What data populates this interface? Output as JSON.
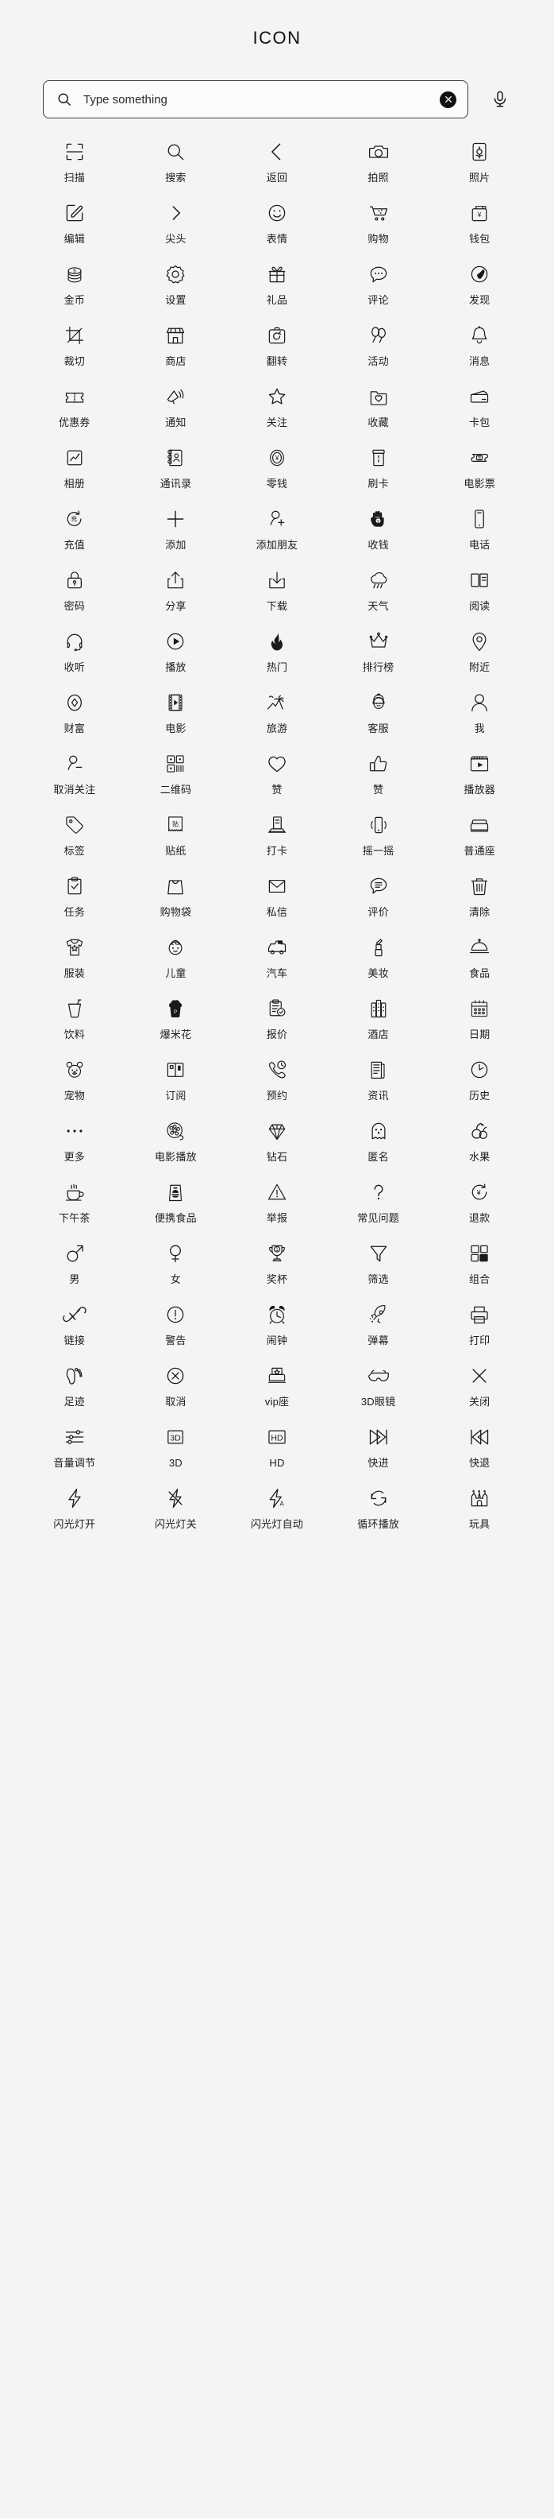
{
  "header": {
    "title": "ICON"
  },
  "search": {
    "placeholder": "Type something",
    "value": "",
    "search_icon": "search-icon",
    "clear_icon": "clear-circle-icon",
    "mic_icon": "microphone-icon"
  },
  "icons": [
    {
      "label": "扫描",
      "icon": "scan-icon"
    },
    {
      "label": "搜索",
      "icon": "search-icon"
    },
    {
      "label": "返回",
      "icon": "chevron-left-icon"
    },
    {
      "label": "拍照",
      "icon": "camera-icon"
    },
    {
      "label": "照片",
      "icon": "photo-icon"
    },
    {
      "label": "编辑",
      "icon": "edit-pencil-icon"
    },
    {
      "label": "尖头",
      "icon": "chevron-right-icon"
    },
    {
      "label": "表情",
      "icon": "smiley-face-icon"
    },
    {
      "label": "购物",
      "icon": "shopping-cart-icon"
    },
    {
      "label": "钱包",
      "icon": "wallet-icon"
    },
    {
      "label": "金币",
      "icon": "coins-icon"
    },
    {
      "label": "设置",
      "icon": "gear-icon"
    },
    {
      "label": "礼品",
      "icon": "gift-icon"
    },
    {
      "label": "评论",
      "icon": "comment-bubble-icon"
    },
    {
      "label": "发现",
      "icon": "compass-globe-icon"
    },
    {
      "label": "裁切",
      "icon": "crop-icon"
    },
    {
      "label": "商店",
      "icon": "storefront-icon"
    },
    {
      "label": "翻转",
      "icon": "camera-flip-icon"
    },
    {
      "label": "活动",
      "icon": "balloons-icon"
    },
    {
      "label": "消息",
      "icon": "bell-icon"
    },
    {
      "label": "优惠券",
      "icon": "coupon-ticket-icon"
    },
    {
      "label": "通知",
      "icon": "notification-horn-icon"
    },
    {
      "label": "关注",
      "icon": "star-outline-icon"
    },
    {
      "label": "收藏",
      "icon": "folder-heart-icon"
    },
    {
      "label": "卡包",
      "icon": "card-stack-icon"
    },
    {
      "label": "相册",
      "icon": "album-chart-icon"
    },
    {
      "label": "通讯录",
      "icon": "contacts-book-icon"
    },
    {
      "label": "零钱",
      "icon": "coin-yuan-icon"
    },
    {
      "label": "刷卡",
      "icon": "card-swipe-icon"
    },
    {
      "label": "电影票",
      "icon": "movie-ticket-icon"
    },
    {
      "label": "充值",
      "icon": "recharge-icon"
    },
    {
      "label": "添加",
      "icon": "plus-icon"
    },
    {
      "label": "添加朋友",
      "icon": "add-friend-icon"
    },
    {
      "label": "收钱",
      "icon": "receive-money-hand-icon"
    },
    {
      "label": "电话",
      "icon": "phone-device-icon"
    },
    {
      "label": "密码",
      "icon": "lock-icon"
    },
    {
      "label": "分享",
      "icon": "share-upload-icon"
    },
    {
      "label": "下载",
      "icon": "download-icon"
    },
    {
      "label": "天气",
      "icon": "rain-cloud-icon"
    },
    {
      "label": "阅读",
      "icon": "open-book-icon"
    },
    {
      "label": "收听",
      "icon": "headset-icon"
    },
    {
      "label": "播放",
      "icon": "play-circle-icon"
    },
    {
      "label": "热门",
      "icon": "flame-icon"
    },
    {
      "label": "排行榜",
      "icon": "crown-icon"
    },
    {
      "label": "附近",
      "icon": "location-pin-icon"
    },
    {
      "label": "财富",
      "icon": "wealth-coin-icon"
    },
    {
      "label": "电影",
      "icon": "film-strip-icon"
    },
    {
      "label": "旅游",
      "icon": "palm-travel-icon"
    },
    {
      "label": "客服",
      "icon": "customer-service-icon"
    },
    {
      "label": "我",
      "icon": "user-icon"
    },
    {
      "label": "取消关注",
      "icon": "remove-friend-icon"
    },
    {
      "label": "二维码",
      "icon": "qr-code-icon"
    },
    {
      "label": "赞",
      "icon": "heart-outline-icon"
    },
    {
      "label": "赞",
      "icon": "thumbs-up-icon"
    },
    {
      "label": "播放器",
      "icon": "video-player-icon"
    },
    {
      "label": "标签",
      "icon": "tag-icon"
    },
    {
      "label": "贴纸",
      "icon": "sticker-icon"
    },
    {
      "label": "打卡",
      "icon": "check-in-icon"
    },
    {
      "label": "摇一摇",
      "icon": "shake-phone-icon"
    },
    {
      "label": "普通座",
      "icon": "normal-seat-icon"
    },
    {
      "label": "任务",
      "icon": "task-clipboard-icon"
    },
    {
      "label": "购物袋",
      "icon": "shopping-bag-icon"
    },
    {
      "label": "私信",
      "icon": "envelope-icon"
    },
    {
      "label": "评价",
      "icon": "review-bubble-icon"
    },
    {
      "label": "清除",
      "icon": "trash-icon"
    },
    {
      "label": "服装",
      "icon": "clothing-icon"
    },
    {
      "label": "儿童",
      "icon": "child-face-icon"
    },
    {
      "label": "汽车",
      "icon": "car-icon"
    },
    {
      "label": "美妆",
      "icon": "lipstick-icon"
    },
    {
      "label": "食品",
      "icon": "food-cloche-icon"
    },
    {
      "label": "饮料",
      "icon": "drink-cup-icon"
    },
    {
      "label": "爆米花",
      "icon": "popcorn-icon"
    },
    {
      "label": "报价",
      "icon": "quote-clipboard-icon"
    },
    {
      "label": "酒店",
      "icon": "hotel-building-icon"
    },
    {
      "label": "日期",
      "icon": "calendar-icon"
    },
    {
      "label": "宠物",
      "icon": "pet-bear-icon"
    },
    {
      "label": "订阅",
      "icon": "subscribe-book-icon"
    },
    {
      "label": "预约",
      "icon": "appointment-phone-icon"
    },
    {
      "label": "资讯",
      "icon": "news-icon"
    },
    {
      "label": "历史",
      "icon": "clock-history-icon"
    },
    {
      "label": "更多",
      "icon": "more-dots-icon"
    },
    {
      "label": "电影播放",
      "icon": "film-reel-icon"
    },
    {
      "label": "钻石",
      "icon": "diamond-icon"
    },
    {
      "label": "匿名",
      "icon": "ghost-anonymous-icon"
    },
    {
      "label": "水果",
      "icon": "fruit-icon"
    },
    {
      "label": "下午茶",
      "icon": "tea-cup-icon"
    },
    {
      "label": "便携食品",
      "icon": "takeaway-food-icon"
    },
    {
      "label": "举报",
      "icon": "warning-triangle-icon"
    },
    {
      "label": "常见问题",
      "icon": "question-mark-icon"
    },
    {
      "label": "退款",
      "icon": "refund-yuan-icon"
    },
    {
      "label": "男",
      "icon": "male-icon"
    },
    {
      "label": "女",
      "icon": "female-icon"
    },
    {
      "label": "奖杯",
      "icon": "trophy-icon"
    },
    {
      "label": "筛选",
      "icon": "filter-funnel-icon"
    },
    {
      "label": "组合",
      "icon": "grid-combo-icon"
    },
    {
      "label": "链接",
      "icon": "link-chain-icon"
    },
    {
      "label": "警告",
      "icon": "exclamation-circle-icon"
    },
    {
      "label": "闹钟",
      "icon": "alarm-clock-icon"
    },
    {
      "label": "弹幕",
      "icon": "rocket-icon"
    },
    {
      "label": "打印",
      "icon": "printer-icon"
    },
    {
      "label": "足迹",
      "icon": "footprint-icon"
    },
    {
      "label": "取消",
      "icon": "cancel-circle-icon"
    },
    {
      "label": "vip座",
      "icon": "vip-seat-icon"
    },
    {
      "label": "3D眼镜",
      "icon": "3d-glasses-icon"
    },
    {
      "label": "关闭",
      "icon": "close-x-icon"
    },
    {
      "label": "音量调节",
      "icon": "volume-slider-icon"
    },
    {
      "label": "3D",
      "icon": "3d-badge-icon"
    },
    {
      "label": "HD",
      "icon": "hd-badge-icon"
    },
    {
      "label": "快进",
      "icon": "fast-forward-icon"
    },
    {
      "label": "快退",
      "icon": "rewind-icon"
    },
    {
      "label": "闪光灯开",
      "icon": "flash-on-icon"
    },
    {
      "label": "闪光灯关",
      "icon": "flash-off-icon"
    },
    {
      "label": "闪光灯自动",
      "icon": "flash-auto-icon"
    },
    {
      "label": "循环播放",
      "icon": "loop-play-icon"
    },
    {
      "label": "玩具",
      "icon": "toy-castle-icon"
    }
  ],
  "colors": {
    "background": "#f4f4f4",
    "stroke": "#1a1a1a",
    "text": "#1d1d1d",
    "search_border": "#3c3c3c",
    "clear_button": "#111111"
  }
}
